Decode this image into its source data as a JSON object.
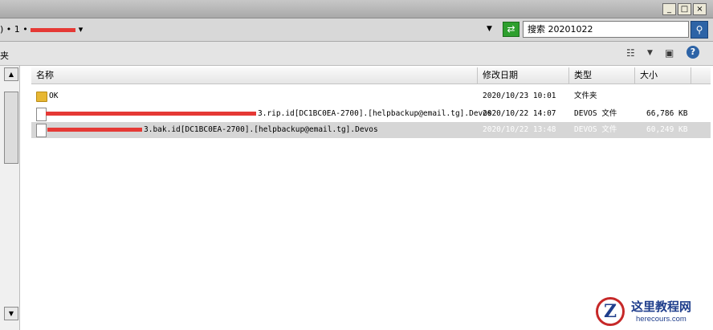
{
  "window": {
    "minimize_label": "_",
    "maximize_label": "□",
    "close_label": "×"
  },
  "address_bar": {
    "path_prefix": ") • 1 •",
    "dropdown_glyph": "▾",
    "refresh_icon": "refresh-icon"
  },
  "search": {
    "value": "搜索 20201022",
    "button_icon": "magnifier-icon"
  },
  "toolbar": {
    "left_label": "夹",
    "view_options_icon": "view-options-icon",
    "preview_pane_icon": "preview-pane-icon",
    "help_label": "?"
  },
  "columns": {
    "name": "名称",
    "date": "修改日期",
    "type": "类型",
    "size": "大小"
  },
  "files": [
    {
      "icon": "folder-icon",
      "name": "OK",
      "date": "2020/10/23 10:01",
      "type": "文件夹",
      "size": "",
      "selected": false
    },
    {
      "icon": "file-icon",
      "name": "3.rip.id[DC1BC0EA-2700].[helpbackup@email.tg].Devos",
      "date": "2020/10/22 14:07",
      "type": "DEVOS 文件",
      "size": "66,786 KB",
      "selected": false
    },
    {
      "icon": "file-icon",
      "name": "3.bak.id[DC1BC0EA-2700].[helpbackup@email.tg].Devos",
      "date": "2020/10/22 13:48",
      "type": "DEVOS 文件",
      "size": "60,249 KB",
      "selected": true
    }
  ],
  "watermark": {
    "logo_letter": "Z",
    "title": "这里教程网",
    "url": "herecours.com"
  },
  "colors": {
    "redaction": "#e53935",
    "selection": "#d6d6d6",
    "folder": "#e7b733",
    "watermark_blue": "#1f3e8c"
  }
}
